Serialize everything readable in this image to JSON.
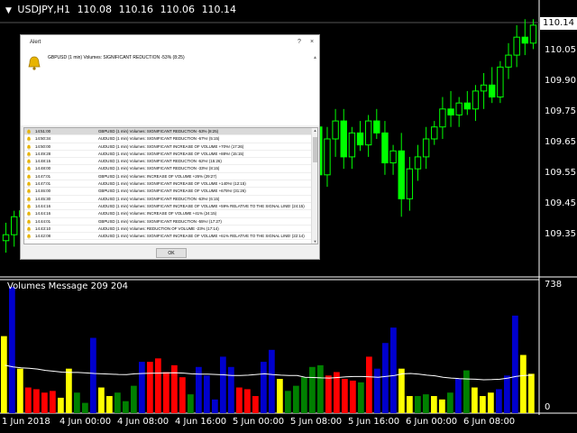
{
  "header": {
    "symbol": "USDJPY,H1",
    "open": "110.08",
    "high": "110.16",
    "low": "110.06",
    "close": "110.14"
  },
  "price_axis": {
    "current": "110.14",
    "labels": [
      "110.05",
      "109.90",
      "109.75",
      "109.65",
      "109.55",
      "109.45",
      "109.35"
    ]
  },
  "indicator": {
    "title": "Volumes Message 209 204",
    "max_label": "738",
    "min_label": "0"
  },
  "time_axis": [
    "1 Jun 2018",
    "4 Jun 00:00",
    "4 Jun 08:00",
    "4 Jun 16:00",
    "5 Jun 00:00",
    "5 Jun 08:00",
    "5 Jun 16:00",
    "6 Jun 00:00",
    "6 Jun 08:00"
  ],
  "alert": {
    "title": "Alert",
    "help_btn": "?",
    "close_btn": "×",
    "message": "GBPUSD (1 min) Volumes: SIGNIFICANT REDUCTION -53% (8:25)",
    "ok_label": "OK",
    "rows": [
      {
        "time": "14:51:00",
        "text": "GBPUSD (1 min) Volumes: SIGNIFICANT REDUCTION -53% (8:25)"
      },
      {
        "time": "14:50:34",
        "text": "AUDUSD (1 min) Volumes: SIGNIFICANT REDUCTION -67%! (5:15)"
      },
      {
        "time": "14:50:00",
        "text": "AUDUSD (1 min) Volumes: SIGNIFICANT INCREASE OF VOLUME +70%! (17:26)"
      },
      {
        "time": "14:49:28",
        "text": "AUDUSD (1 min) Volumes: SIGNIFICANT INCREASE OF VOLUME +88%! (15:15)"
      },
      {
        "time": "14:48:15",
        "text": "AUDUSD (1 min) Volumes: SIGNIFICANT REDUCTION -62%! (15:26)"
      },
      {
        "time": "14:48:00",
        "text": "AUDUSD (1 min) Volumes: SIGNIFICANT REDUCTION -33%! (8:15)"
      },
      {
        "time": "14:47:01",
        "text": "GBPUSD (1 min) Volumes: INCREASE OF VOLUME +26% (29:27)"
      },
      {
        "time": "14:47:01",
        "text": "AUDUSD (1 min) Volumes: SIGNIFICANT INCREASE OF VOLUME +140%! (12:15)"
      },
      {
        "time": "14:46:00",
        "text": "GBPUSD (1 min) Volumes: SIGNIFICANT INCREASE OF VOLUME +675%! (31:26)"
      },
      {
        "time": "14:45:30",
        "text": "AUDUSD (1 min) Volumes: SIGNIFICANT REDUCTION -63%! (6:15)"
      },
      {
        "time": "14:44:16",
        "text": "AUDUSD (1 min) Volumes: SIGNIFICANT INCREASE OF VOLUME +59% RELATIVE TO THE SIGNAL LINE! (24:15)"
      },
      {
        "time": "14:44:16",
        "text": "AUDUSD (1 min) Volumes: INCREASE OF VOLUME +41% (24:15)"
      },
      {
        "time": "14:44:01",
        "text": "GBPUSD (1 min) Volumes: SIGNIFICANT REDUCTION -55%! (17:27)"
      },
      {
        "time": "14:43:10",
        "text": "AUDUSD (1 min) Volumes: REDUCTION OF VOLUME -23% (17:14)"
      },
      {
        "time": "14:42:08",
        "text": "AUDUSD (1 min) Volumes: SIGNIFICANT INCREASE OF VOLUME +61% RELATIVE TO THE SIGNAL LINE! (22:14)"
      }
    ]
  },
  "chart_data": {
    "type": "candlestick+volume",
    "price_ylim": [
      109.32,
      110.2
    ],
    "candles": [
      [
        109.42,
        109.48,
        109.38,
        109.44
      ],
      [
        109.44,
        109.52,
        109.4,
        109.5
      ],
      [
        109.5,
        109.58,
        109.46,
        109.52
      ],
      [
        109.52,
        109.6,
        109.48,
        109.55
      ],
      [
        109.55,
        109.62,
        109.5,
        109.58
      ],
      [
        109.58,
        109.66,
        109.54,
        109.62
      ],
      [
        109.62,
        109.7,
        109.58,
        109.64
      ],
      [
        109.64,
        109.72,
        109.6,
        109.68
      ],
      [
        109.68,
        109.76,
        109.64,
        109.7
      ],
      [
        109.7,
        109.78,
        109.66,
        109.74
      ],
      [
        109.74,
        109.82,
        109.7,
        109.76
      ],
      [
        109.76,
        109.84,
        109.72,
        109.8
      ],
      [
        109.8,
        109.86,
        109.74,
        109.78
      ],
      [
        109.78,
        109.84,
        109.72,
        109.82
      ],
      [
        109.82,
        109.88,
        109.76,
        109.8
      ],
      [
        109.8,
        109.86,
        109.74,
        109.76
      ],
      [
        109.76,
        109.82,
        109.7,
        109.78
      ],
      [
        109.78,
        109.84,
        109.72,
        109.74
      ],
      [
        109.74,
        109.8,
        109.68,
        109.76
      ],
      [
        109.76,
        109.82,
        109.7,
        109.72
      ],
      [
        109.72,
        109.78,
        109.66,
        109.74
      ],
      [
        109.74,
        109.8,
        109.68,
        109.7
      ],
      [
        109.7,
        109.76,
        109.64,
        109.72
      ],
      [
        109.72,
        109.78,
        109.66,
        109.74
      ],
      [
        109.74,
        109.8,
        109.7,
        109.76
      ],
      [
        109.76,
        109.82,
        109.72,
        109.78
      ],
      [
        109.78,
        109.84,
        109.74,
        109.8
      ],
      [
        109.8,
        109.86,
        109.76,
        109.82
      ],
      [
        109.82,
        109.86,
        109.78,
        109.84
      ],
      [
        109.84,
        109.88,
        109.8,
        109.82
      ],
      [
        109.82,
        109.86,
        109.78,
        109.84
      ],
      [
        109.84,
        109.88,
        109.8,
        109.82
      ],
      [
        109.82,
        109.86,
        109.78,
        109.8
      ],
      [
        109.8,
        109.84,
        109.76,
        109.82
      ],
      [
        109.82,
        109.86,
        109.78,
        109.84
      ],
      [
        109.84,
        109.88,
        109.8,
        109.86
      ],
      [
        109.86,
        109.89,
        109.82,
        109.84
      ],
      [
        109.84,
        109.88,
        109.8,
        109.82
      ],
      [
        109.8,
        109.86,
        109.6,
        109.64
      ],
      [
        109.64,
        109.8,
        109.6,
        109.76
      ],
      [
        109.76,
        109.86,
        109.7,
        109.82
      ],
      [
        109.82,
        109.86,
        109.66,
        109.7
      ],
      [
        109.7,
        109.8,
        109.66,
        109.78
      ],
      [
        109.78,
        109.82,
        109.72,
        109.74
      ],
      [
        109.74,
        109.84,
        109.7,
        109.82
      ],
      [
        109.82,
        109.86,
        109.76,
        109.78
      ],
      [
        109.78,
        109.82,
        109.64,
        109.68
      ],
      [
        109.68,
        109.74,
        109.64,
        109.72
      ],
      [
        109.72,
        109.78,
        109.5,
        109.56
      ],
      [
        109.56,
        109.7,
        109.52,
        109.66
      ],
      [
        109.66,
        109.74,
        109.62,
        109.7
      ],
      [
        109.7,
        109.8,
        109.66,
        109.76
      ],
      [
        109.76,
        109.82,
        109.74,
        109.8
      ],
      [
        109.8,
        109.9,
        109.76,
        109.86
      ],
      [
        109.86,
        109.92,
        109.8,
        109.84
      ],
      [
        109.84,
        109.9,
        109.8,
        109.88
      ],
      [
        109.88,
        109.92,
        109.84,
        109.86
      ],
      [
        109.86,
        109.94,
        109.82,
        109.92
      ],
      [
        109.92,
        109.98,
        109.86,
        109.94
      ],
      [
        109.94,
        110.0,
        109.88,
        109.9
      ],
      [
        109.9,
        110.02,
        109.88,
        110.0
      ],
      [
        110.0,
        110.08,
        109.96,
        110.04
      ],
      [
        110.04,
        110.14,
        110.0,
        110.1
      ],
      [
        110.1,
        110.16,
        110.04,
        110.08
      ],
      [
        110.08,
        110.16,
        110.06,
        110.14
      ]
    ],
    "volume_ylim": [
      0,
      738
    ],
    "volumes": [
      {
        "v": 450,
        "c": "yellow"
      },
      {
        "v": 738,
        "c": "blue"
      },
      {
        "v": 260,
        "c": "yellow"
      },
      {
        "v": 150,
        "c": "red"
      },
      {
        "v": 140,
        "c": "red"
      },
      {
        "v": 120,
        "c": "red"
      },
      {
        "v": 130,
        "c": "red"
      },
      {
        "v": 90,
        "c": "yellow"
      },
      {
        "v": 260,
        "c": "yellow"
      },
      {
        "v": 120,
        "c": "green"
      },
      {
        "v": 60,
        "c": "green"
      },
      {
        "v": 440,
        "c": "blue"
      },
      {
        "v": 150,
        "c": "yellow"
      },
      {
        "v": 100,
        "c": "yellow"
      },
      {
        "v": 120,
        "c": "green"
      },
      {
        "v": 70,
        "c": "green"
      },
      {
        "v": 160,
        "c": "green"
      },
      {
        "v": 300,
        "c": "blue"
      },
      {
        "v": 300,
        "c": "red"
      },
      {
        "v": 320,
        "c": "red"
      },
      {
        "v": 240,
        "c": "red"
      },
      {
        "v": 280,
        "c": "red"
      },
      {
        "v": 210,
        "c": "red"
      },
      {
        "v": 110,
        "c": "green"
      },
      {
        "v": 270,
        "c": "blue"
      },
      {
        "v": 220,
        "c": "blue"
      },
      {
        "v": 80,
        "c": "blue"
      },
      {
        "v": 330,
        "c": "blue"
      },
      {
        "v": 270,
        "c": "blue"
      },
      {
        "v": 150,
        "c": "red"
      },
      {
        "v": 140,
        "c": "red"
      },
      {
        "v": 100,
        "c": "red"
      },
      {
        "v": 300,
        "c": "blue"
      },
      {
        "v": 370,
        "c": "blue"
      },
      {
        "v": 200,
        "c": "yellow"
      },
      {
        "v": 130,
        "c": "green"
      },
      {
        "v": 160,
        "c": "green"
      },
      {
        "v": 210,
        "c": "green"
      },
      {
        "v": 270,
        "c": "green"
      },
      {
        "v": 280,
        "c": "green"
      },
      {
        "v": 220,
        "c": "red"
      },
      {
        "v": 240,
        "c": "red"
      },
      {
        "v": 200,
        "c": "red"
      },
      {
        "v": 190,
        "c": "red"
      },
      {
        "v": 180,
        "c": "green"
      },
      {
        "v": 330,
        "c": "red"
      },
      {
        "v": 260,
        "c": "blue"
      },
      {
        "v": 410,
        "c": "blue"
      },
      {
        "v": 500,
        "c": "blue"
      },
      {
        "v": 260,
        "c": "yellow"
      },
      {
        "v": 100,
        "c": "yellow"
      },
      {
        "v": 100,
        "c": "green"
      },
      {
        "v": 110,
        "c": "green"
      },
      {
        "v": 100,
        "c": "yellow"
      },
      {
        "v": 80,
        "c": "yellow"
      },
      {
        "v": 120,
        "c": "green"
      },
      {
        "v": 200,
        "c": "blue"
      },
      {
        "v": 250,
        "c": "green"
      },
      {
        "v": 150,
        "c": "yellow"
      },
      {
        "v": 100,
        "c": "yellow"
      },
      {
        "v": 120,
        "c": "yellow"
      },
      {
        "v": 140,
        "c": "blue"
      },
      {
        "v": 220,
        "c": "blue"
      },
      {
        "v": 570,
        "c": "blue"
      },
      {
        "v": 340,
        "c": "yellow"
      },
      {
        "v": 230,
        "c": "yellow"
      }
    ],
    "signal_line": [
      280,
      270,
      265,
      262,
      258,
      250,
      245,
      240,
      238,
      238,
      235,
      232,
      230,
      228,
      226,
      225,
      230,
      232,
      233,
      234,
      235,
      236,
      234,
      230,
      228,
      228,
      226,
      224,
      220,
      220,
      222,
      226,
      230,
      225,
      222,
      220,
      220,
      210,
      208,
      206,
      205,
      208,
      212,
      214,
      214,
      212,
      210,
      215,
      220,
      230,
      232,
      228,
      222,
      218,
      210,
      205,
      202,
      200,
      198,
      195,
      196,
      198,
      205,
      215,
      220,
      222
    ],
    "colors": {
      "bull": "#00ff00",
      "bear": "#00ff00",
      "yellow": "#ffff00",
      "red": "#ff0000",
      "green": "#008000",
      "blue": "#0000cd",
      "signal": "#ffffff",
      "grid": "#333333"
    }
  }
}
